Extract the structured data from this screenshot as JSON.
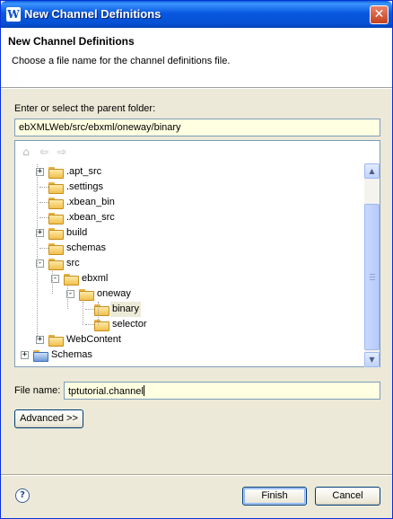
{
  "window": {
    "title": "New Channel Definitions",
    "close_glyph": "✕"
  },
  "header": {
    "title": "New Channel Definitions",
    "subtitle": "Choose a file name for the channel definitions file."
  },
  "parent_folder": {
    "label": "Enter or select the parent folder:",
    "value": "ebXMLWeb/src/ebxml/oneway/binary"
  },
  "tree": {
    "toolbar": [
      {
        "name": "home-icon",
        "glyph": "⌂"
      },
      {
        "name": "back-icon",
        "glyph": "⇦"
      },
      {
        "name": "forward-icon",
        "glyph": "⇨"
      }
    ],
    "nodes": [
      {
        "label": ".apt_src",
        "expander": "+",
        "depth": 1
      },
      {
        "label": ".settings",
        "expander": "",
        "depth": 1
      },
      {
        "label": ".xbean_bin",
        "expander": "",
        "depth": 1
      },
      {
        "label": ".xbean_src",
        "expander": "",
        "depth": 1
      },
      {
        "label": "build",
        "expander": "+",
        "depth": 1
      },
      {
        "label": "schemas",
        "expander": "",
        "depth": 1
      },
      {
        "label": "src",
        "expander": "−",
        "depth": 1
      },
      {
        "label": "ebxml",
        "expander": "−",
        "depth": 2
      },
      {
        "label": "oneway",
        "expander": "−",
        "depth": 3
      },
      {
        "label": "binary",
        "expander": "",
        "depth": 4,
        "selected": true
      },
      {
        "label": "selector",
        "expander": "",
        "depth": 4
      },
      {
        "label": "WebContent",
        "expander": "+",
        "depth": 1
      },
      {
        "label": "Schemas",
        "expander": "+",
        "depth": 0,
        "project": true
      }
    ]
  },
  "file_name": {
    "label": "File name:",
    "value": "tptutorial.channel"
  },
  "advanced_button": "Advanced >>",
  "footer": {
    "help_glyph": "?",
    "finish_label": "Finish",
    "cancel_label": "Cancel"
  }
}
